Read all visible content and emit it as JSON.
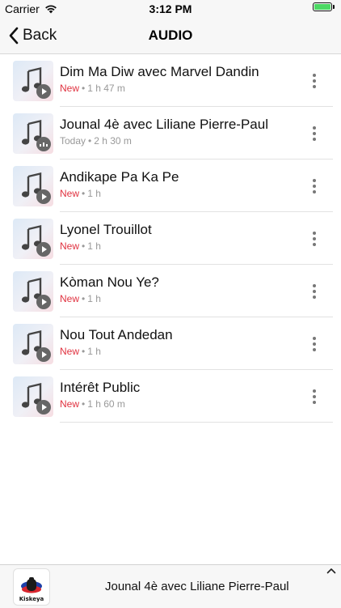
{
  "status_bar": {
    "carrier": "Carrier",
    "time": "3:12 PM",
    "battery_level": 1.0,
    "battery_color": "#4cd964"
  },
  "nav": {
    "back_label": "Back",
    "title": "AUDIO"
  },
  "episodes": [
    {
      "title": "Dim Ma Diw avec Marvel Dandin",
      "status": "New",
      "duration": "1 h 47 m",
      "badge": "play-icon"
    },
    {
      "title": "Jounal 4è avec Liliane Pierre-Paul",
      "status": "Today",
      "duration": "2 h 30 m",
      "badge": "more-badge-icon"
    },
    {
      "title": "Andikape Pa Ka Pe",
      "status": "New",
      "duration": "1 h",
      "badge": "play-icon"
    },
    {
      "title": "Lyonel Trouillot",
      "status": "New",
      "duration": "1 h",
      "badge": "play-icon"
    },
    {
      "title": "Kòman Nou Ye?",
      "status": "New",
      "duration": "1 h",
      "badge": "play-icon"
    },
    {
      "title": "Nou Tout Andedan",
      "status": "New",
      "duration": "1 h",
      "badge": "play-icon"
    },
    {
      "title": "Intérêt Public",
      "status": "New",
      "duration": "1 h 60 m",
      "badge": "play-icon"
    }
  ],
  "separator": "•",
  "player": {
    "logo_text": "Kiskeya",
    "title": "Jounal 4è avec Liliane Pierre-Paul"
  },
  "colors": {
    "new": "#e0313f",
    "meta": "#999999",
    "bar_bg": "#f7f7f7"
  }
}
